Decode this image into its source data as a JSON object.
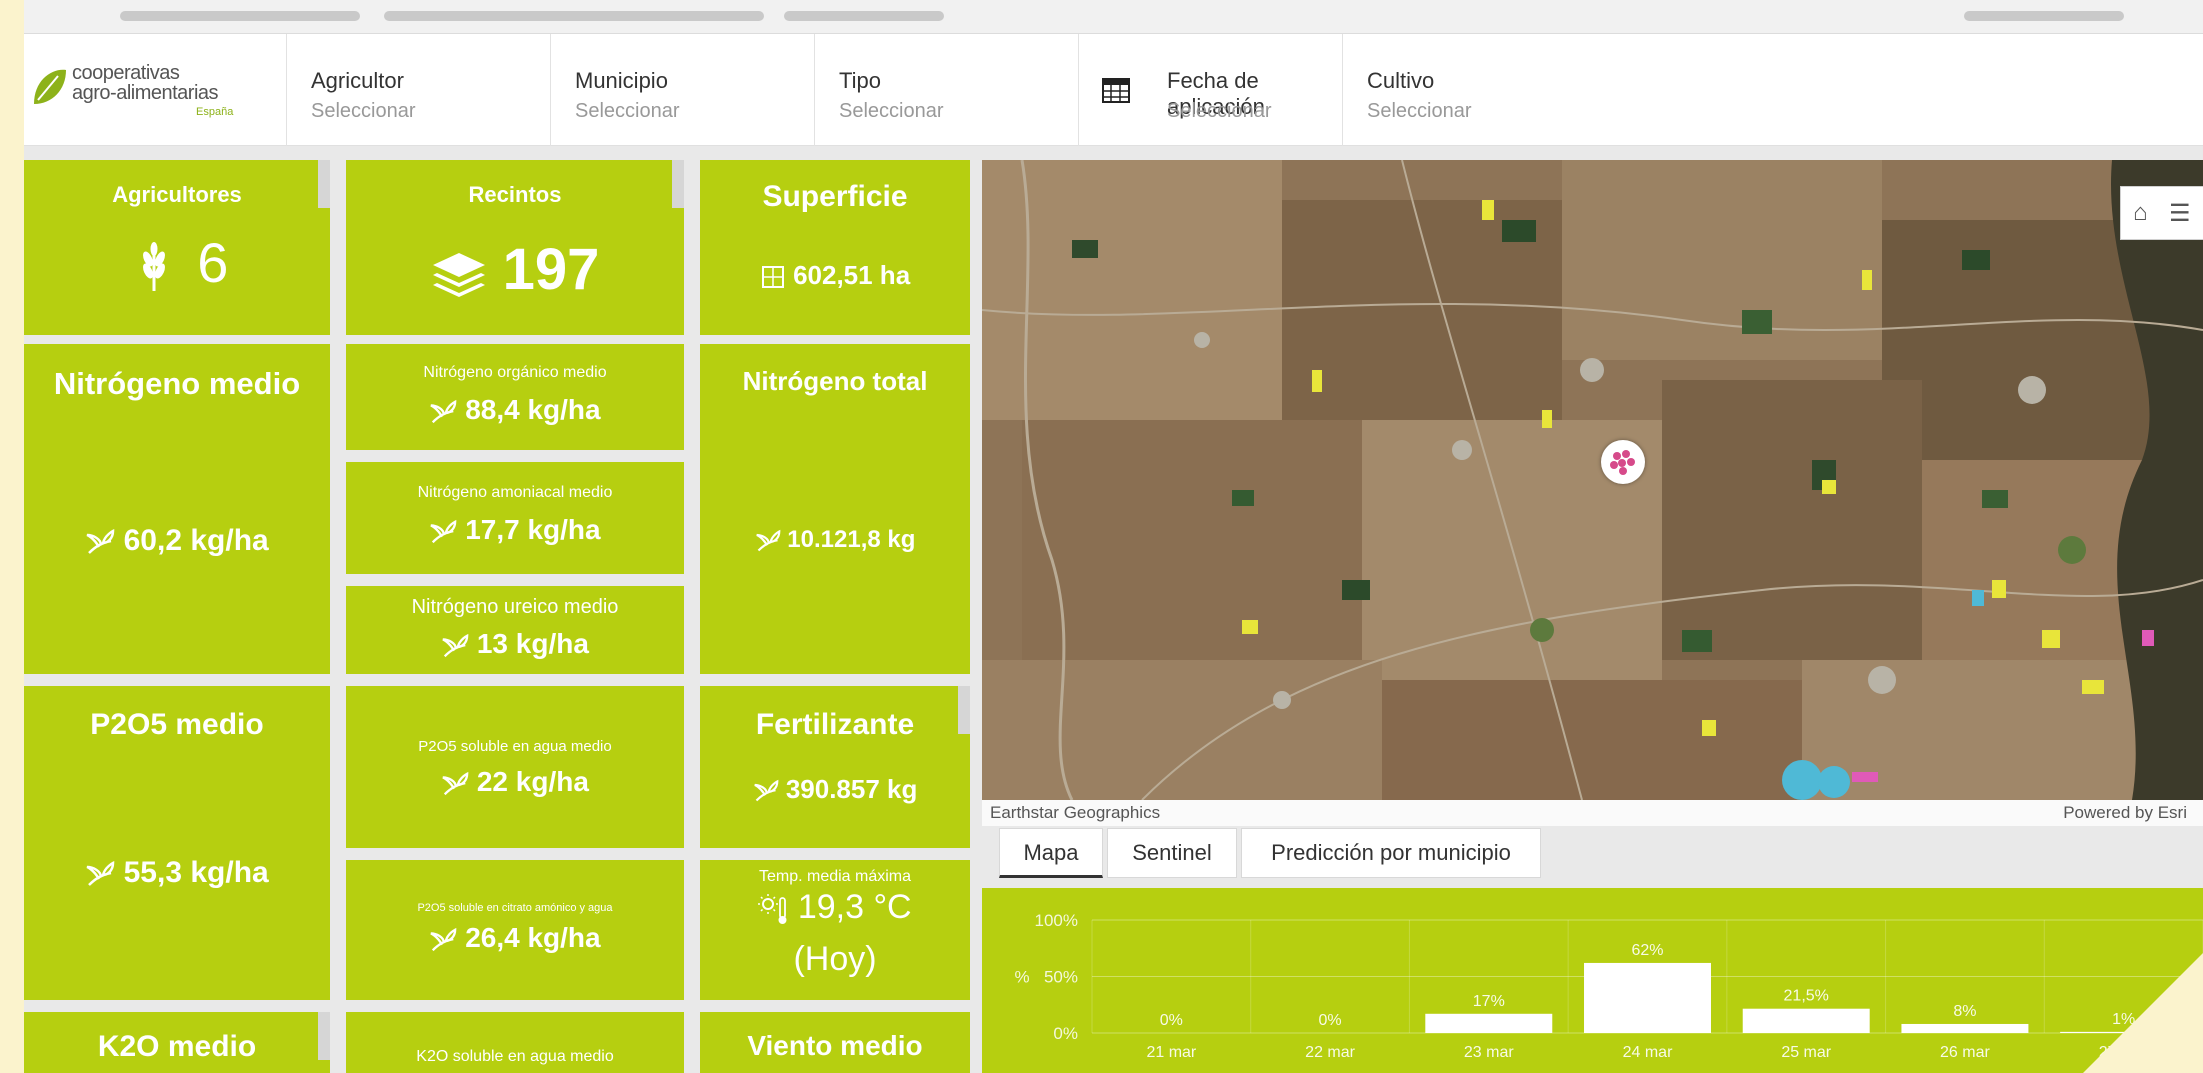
{
  "logo": {
    "line1": "cooperativas",
    "line2": "agro-alimentarias",
    "line3": "España"
  },
  "filters": [
    {
      "label": "Agricultor",
      "value": "Seleccionar"
    },
    {
      "label": "Municipio",
      "value": "Seleccionar"
    },
    {
      "label": "Tipo",
      "value": "Seleccionar"
    },
    {
      "label": "Fecha de aplicación",
      "value": "Seleccionar"
    },
    {
      "label": "Cultivo",
      "value": "Seleccionar"
    }
  ],
  "tiles": {
    "agricultores": {
      "title": "Agricultores",
      "value": "6"
    },
    "recintos": {
      "title": "Recintos",
      "value": "197"
    },
    "superficie": {
      "title": "Superficie",
      "value": "602,51 ha"
    },
    "nitrogeno_medio": {
      "title": "Nitrógeno medio",
      "value": "60,2 kg/ha"
    },
    "nitrogeno_organico": {
      "title": "Nitrógeno orgánico medio",
      "value": "88,4 kg/ha"
    },
    "nitrogeno_amoniacal": {
      "title": "Nitrógeno amoniacal medio",
      "value": "17,7 kg/ha"
    },
    "nitrogeno_ureico": {
      "title": "Nitrógeno ureico medio",
      "value": "13 kg/ha"
    },
    "nitrogeno_total": {
      "title": "Nitrógeno total",
      "value": "10.121,8 kg"
    },
    "p2o5_medio": {
      "title": "P2O5 medio",
      "value": "55,3 kg/ha"
    },
    "p2o5_soluble_agua": {
      "title": "P2O5 soluble en agua medio",
      "value": "22 kg/ha"
    },
    "p2o5_citrato": {
      "title": "P2O5 soluble en citrato amónico y agua",
      "value": "26,4 kg/ha"
    },
    "fertilizante": {
      "title": "Fertilizante",
      "value": "390.857 kg"
    },
    "temp_media": {
      "title": "Temp. media máxima",
      "value": "19,3 °C",
      "sub": "(Hoy)"
    },
    "k2o_medio": {
      "title": "K2O medio"
    },
    "k2o_soluble": {
      "title": "K2O soluble en agua medio"
    },
    "viento_medio": {
      "title": "Viento medio"
    }
  },
  "map": {
    "attribution": "Earthstar Geographics",
    "powered": "Powered by Esri"
  },
  "tabs": [
    {
      "label": "Mapa",
      "active": true
    },
    {
      "label": "Sentinel",
      "active": false
    },
    {
      "label": "Predicción por municipio",
      "active": false
    }
  ],
  "colors": {
    "accent": "#b6cf10",
    "text_on_accent": "#ffffff"
  },
  "chart_data": {
    "type": "bar",
    "ylabel": "%",
    "yticks": [
      "0%",
      "50%",
      "100%"
    ],
    "ylim": [
      0,
      100
    ],
    "grid": true,
    "categories": [
      "21 mar",
      "22 mar",
      "23 mar",
      "24 mar",
      "25 mar",
      "26 mar",
      "27 mar"
    ],
    "values": [
      0,
      0,
      17,
      62,
      21.5,
      8,
      1
    ],
    "data_labels": [
      "0%",
      "0%",
      "17%",
      "62%",
      "21,5%",
      "8%",
      "1%"
    ]
  }
}
